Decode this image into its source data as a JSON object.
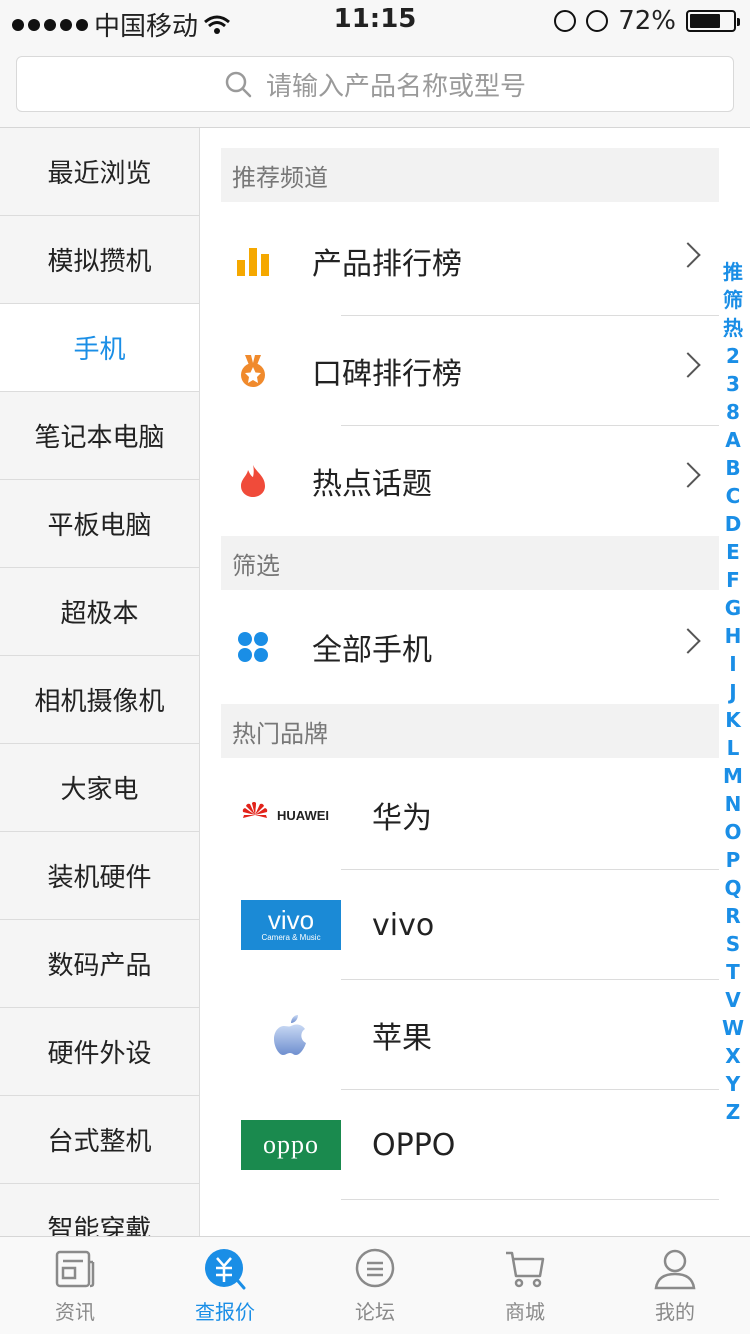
{
  "status_bar": {
    "carrier": "中国移动",
    "time": "11:15",
    "battery": "72%",
    "battery_level": 0.72
  },
  "search": {
    "placeholder": "请输入产品名称或型号"
  },
  "categories": [
    {
      "label": "最近浏览"
    },
    {
      "label": "模拟攒机"
    },
    {
      "label": "手机",
      "active": true
    },
    {
      "label": "笔记本电脑"
    },
    {
      "label": "平板电脑"
    },
    {
      "label": "超极本"
    },
    {
      "label": "相机摄像机"
    },
    {
      "label": "大家电"
    },
    {
      "label": "装机硬件"
    },
    {
      "label": "数码产品"
    },
    {
      "label": "硬件外设"
    },
    {
      "label": "台式整机"
    },
    {
      "label": "智能穿戴"
    }
  ],
  "sections": {
    "recommended": {
      "title": "推荐频道",
      "items": [
        {
          "label": "产品排行榜",
          "icon": "bar-chart-icon"
        },
        {
          "label": "口碑排行榜",
          "icon": "medal-icon"
        },
        {
          "label": "热点话题",
          "icon": "flame-icon"
        }
      ]
    },
    "filter": {
      "title": "筛选",
      "items": [
        {
          "label": "全部手机",
          "icon": "grid-icon"
        }
      ]
    },
    "brands": {
      "title": "热门品牌",
      "items": [
        {
          "label": "华为",
          "logo_text": "HUAWEI"
        },
        {
          "label": "vivo",
          "logo_text": "vivo",
          "logo_subtext": "Camera & Music"
        },
        {
          "label": "苹果",
          "logo_text": ""
        },
        {
          "label": "OPPO",
          "logo_text": "oppo"
        }
      ]
    }
  },
  "alpha_index": [
    "推",
    "筛",
    "热",
    "2",
    "3",
    "8",
    "A",
    "B",
    "C",
    "D",
    "E",
    "F",
    "G",
    "H",
    "I",
    "J",
    "K",
    "L",
    "M",
    "N",
    "O",
    "P",
    "Q",
    "R",
    "S",
    "T",
    "V",
    "W",
    "X",
    "Y",
    "Z"
  ],
  "tabs": [
    {
      "label": "资讯",
      "icon": "news-icon"
    },
    {
      "label": "查报价",
      "icon": "price-search-icon",
      "active": true
    },
    {
      "label": "论坛",
      "icon": "forum-icon"
    },
    {
      "label": "商城",
      "icon": "cart-icon"
    },
    {
      "label": "我的",
      "icon": "user-icon"
    }
  ],
  "colors": {
    "accent": "#1a8ee6",
    "bar_icon": "#f5a800",
    "medal_icon": "#f08a2c",
    "flame_icon": "#f04b3a",
    "grid_icon": "#1a8ee6",
    "huawei_red": "#e2231a",
    "vivo_blue": "#1b8ad6",
    "oppo_green": "#1a8a4e"
  }
}
